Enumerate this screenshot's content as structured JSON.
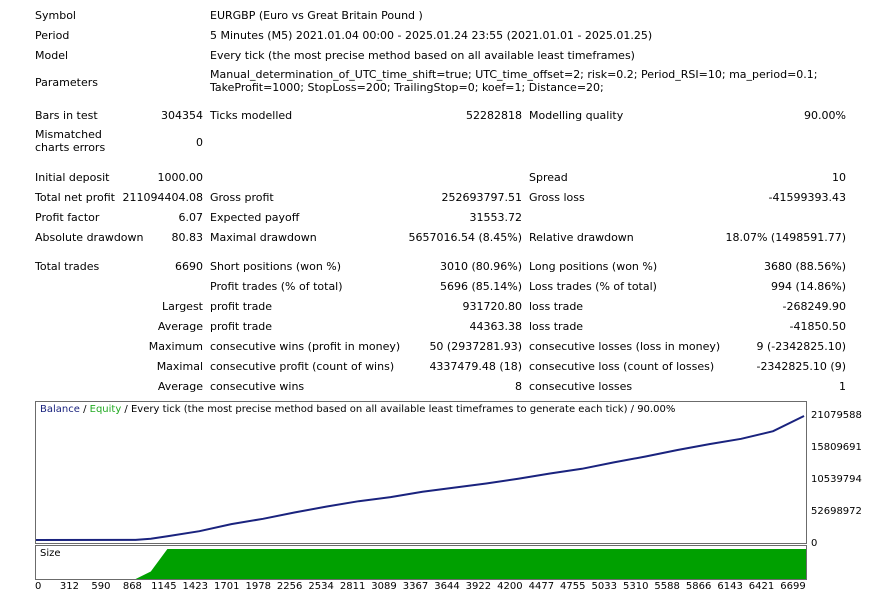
{
  "symbol": {
    "label": "Symbol",
    "value": "EURGBP (Euro vs Great Britain Pound )"
  },
  "period": {
    "label": "Period",
    "value": "5 Minutes (M5) 2021.01.04 00:00 - 2025.01.24 23:55 (2021.01.01 - 2025.01.25)"
  },
  "model": {
    "label": "Model",
    "value": "Every tick (the most precise method based on all available least timeframes)"
  },
  "parameters": {
    "label": "Parameters",
    "value": "Manual_determination_of_UTC_time_shift=true; UTC_time_offset=2; risk=0.2; Period_RSI=10; ma_period=0.1; TakeProfit=1000; StopLoss=200; TrailingStop=0; koef=1; Distance=20;"
  },
  "bars": {
    "label": "Bars in test",
    "value": "304354"
  },
  "ticks": {
    "label": "Ticks modelled",
    "value": "52282818"
  },
  "quality": {
    "label": "Modelling quality",
    "value": "90.00%"
  },
  "mismatch": {
    "label": "Mismatched charts errors",
    "value": "0"
  },
  "deposit": {
    "label": "Initial deposit",
    "value": "1000.00"
  },
  "spread": {
    "label": "Spread",
    "value": "10"
  },
  "net_profit": {
    "label": "Total net profit",
    "value": "211094404.08"
  },
  "gross_profit": {
    "label": "Gross profit",
    "value": "252693797.51"
  },
  "gross_loss": {
    "label": "Gross loss",
    "value": "-41599393.43"
  },
  "profit_factor": {
    "label": "Profit factor",
    "value": "6.07"
  },
  "expected_payoff": {
    "label": "Expected payoff",
    "value": "31553.72"
  },
  "abs_dd": {
    "label": "Absolute drawdown",
    "value": "80.83"
  },
  "max_dd": {
    "label": "Maximal drawdown",
    "value": "5657016.54 (8.45%)"
  },
  "rel_dd": {
    "label": "Relative drawdown",
    "value": "18.07% (1498591.77)"
  },
  "total_trades": {
    "label": "Total trades",
    "value": "6690"
  },
  "short_pos": {
    "label": "Short positions (won %)",
    "value": "3010 (80.96%)"
  },
  "long_pos": {
    "label": "Long positions (won %)",
    "value": "3680 (88.56%)"
  },
  "profit_trades": {
    "label": "Profit trades (% of total)",
    "value": "5696 (85.14%)"
  },
  "loss_trades": {
    "label": "Loss trades (% of total)",
    "value": "994 (14.86%)"
  },
  "largest": {
    "label": "Largest",
    "profit_label": "profit trade",
    "profit": "931720.80",
    "loss_label": "loss trade",
    "loss": "-268249.90"
  },
  "average": {
    "label": "Average",
    "profit_label": "profit trade",
    "profit": "44363.38",
    "loss_label": "loss trade",
    "loss": "-41850.50"
  },
  "maximum": {
    "label": "Maximum",
    "profit_label": "consecutive wins (profit in money)",
    "profit": "50 (2937281.93)",
    "loss_label": "consecutive losses (loss in money)",
    "loss": "9 (-2342825.10)"
  },
  "maximal": {
    "label": "Maximal",
    "profit_label": "consecutive profit (count of wins)",
    "profit": "4337479.48 (18)",
    "loss_label": "consecutive loss (count of losses)",
    "loss": "-2342825.10 (9)"
  },
  "average2": {
    "label": "Average",
    "profit_label": "consecutive wins",
    "profit": "8",
    "loss_label": "consecutive losses",
    "loss": "1"
  },
  "chart_data": {
    "type": "line",
    "title_balance": "Balance",
    "title_sep": " / ",
    "title_equity": "Equity",
    "title_rest": " / Every tick (the most precise method based on all available least timeframes to generate each tick) / 90.00%",
    "size_label": "Size",
    "y_ticks": [
      "21079588",
      "15809691",
      "10539794",
      "52698972",
      "0"
    ],
    "x_ticks": [
      "0",
      "312",
      "590",
      "868",
      "1145",
      "1423",
      "1701",
      "1978",
      "2256",
      "2534",
      "2811",
      "3089",
      "3367",
      "3644",
      "3922",
      "4200",
      "4477",
      "4755",
      "5033",
      "5310",
      "5588",
      "5866",
      "6143",
      "6421",
      "6699"
    ],
    "ylim": [
      0,
      21079588
    ],
    "xlim": [
      0,
      6690
    ],
    "series": [
      {
        "x": [
          0,
          868,
          1000,
          1145,
          1423,
          1701,
          1978,
          2256,
          2534,
          2811,
          3089,
          3367,
          3644,
          3922,
          4200,
          4477,
          4755,
          5033,
          5310,
          5588,
          5866,
          6143,
          6421,
          6690
        ],
        "y": [
          1000,
          20000,
          200000,
          650000,
          1500000,
          2700000,
          3600000,
          4700000,
          5700000,
          6600000,
          7300000,
          8200000,
          8900000,
          9600000,
          10400000,
          11300000,
          12100000,
          13200000,
          14200000,
          15300000,
          16300000,
          17200000,
          18500000,
          21079588
        ]
      }
    ],
    "size_series": {
      "x": [
        0,
        868,
        1000,
        1145,
        1423,
        6690
      ],
      "y": [
        0,
        0,
        0.25,
        1,
        1,
        1
      ]
    },
    "colors": {
      "balance": "#1a237e",
      "equity": "#22aa22",
      "size": "#00a000",
      "grid": "#b0b0b0"
    }
  }
}
